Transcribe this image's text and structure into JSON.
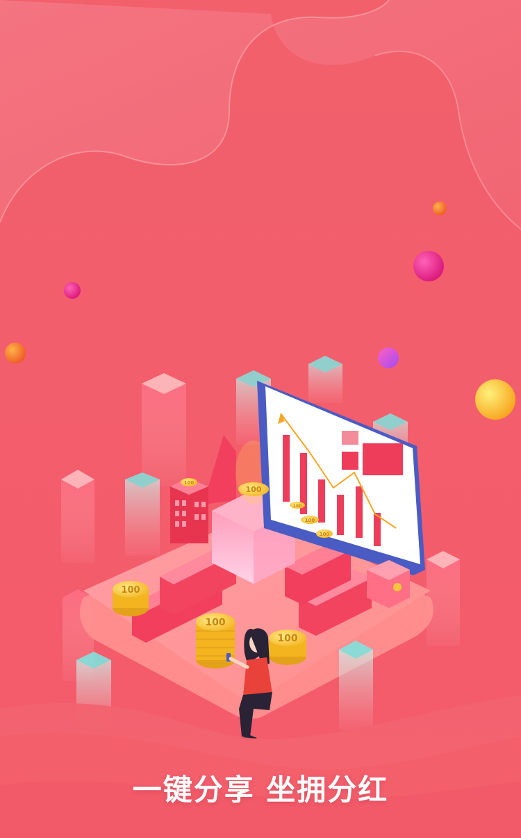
{
  "slogan": "一键分享 坐拥分红",
  "coin_value": "100",
  "colors": {
    "background": "#f25d6c",
    "background_light": "#f57582",
    "accent_coin": "#f7c53a",
    "monitor_frame": "#4a5bc4",
    "bar_red": "#ee3d5a",
    "trend_line": "#f5a623"
  },
  "illustration": {
    "scene": "isometric-city-with-coins-and-chart",
    "icons": [
      "coin-stack-icon",
      "bar-chart-icon",
      "person-with-phone-icon",
      "decorative-ball-icon"
    ]
  }
}
